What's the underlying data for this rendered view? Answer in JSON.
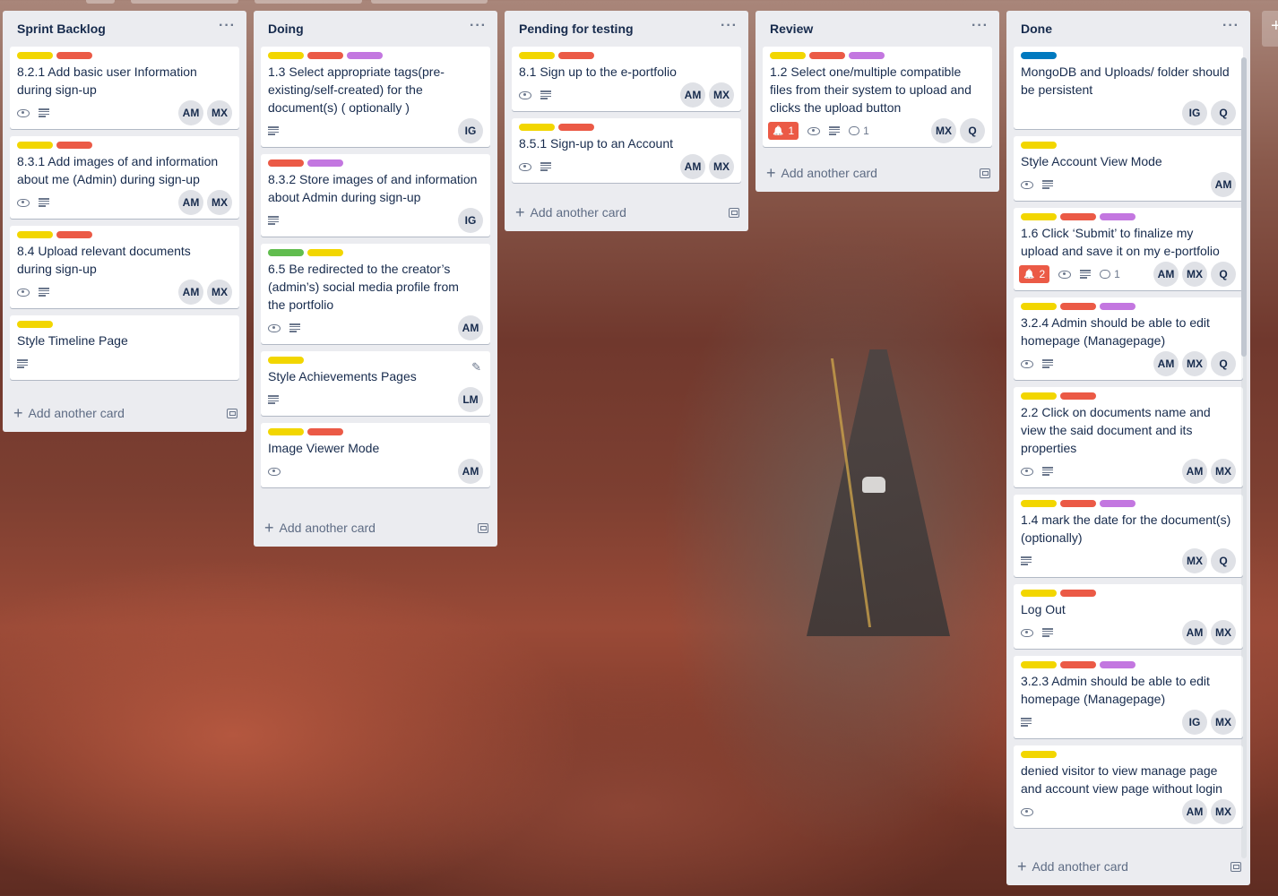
{
  "colors": {
    "yellow": "#f2d600",
    "red": "#eb5a46",
    "purple": "#c377e0",
    "green": "#61bd4f",
    "blue": "#0079bf"
  },
  "common": {
    "add_card_label": "Add another card",
    "list_menu_label": "···"
  },
  "lists": [
    {
      "title": "Sprint Backlog",
      "cards": [
        {
          "labels": [
            "yellow",
            "red"
          ],
          "title": "8.2.1 Add basic user Information during sign-up",
          "icons": [
            "eye-icon",
            "description-icon"
          ],
          "members": [
            "AM",
            "MX"
          ]
        },
        {
          "labels": [
            "yellow",
            "red"
          ],
          "title": "8.3.1 Add images of and information about me (Admin) during sign-up",
          "icons": [
            "eye-icon",
            "description-icon"
          ],
          "members": [
            "AM",
            "MX"
          ]
        },
        {
          "labels": [
            "yellow",
            "red"
          ],
          "title": "8.4 Upload relevant documents during sign-up",
          "icons": [
            "eye-icon",
            "description-icon"
          ],
          "members": [
            "AM",
            "MX"
          ]
        },
        {
          "labels": [
            "yellow"
          ],
          "title": "Style Timeline Page",
          "icons": [
            "description-icon"
          ],
          "members": []
        }
      ]
    },
    {
      "title": "Doing",
      "cards": [
        {
          "labels": [
            "yellow",
            "red",
            "purple"
          ],
          "title": "1.3 Select appropriate tags(pre-existing/self-created) for the document(s) ( optionally )",
          "icons": [
            "description-icon"
          ],
          "members": [
            "IG"
          ]
        },
        {
          "labels": [
            "red",
            "purple"
          ],
          "title": "8.3.2 Store images of and information about Admin during sign-up",
          "icons": [
            "description-icon"
          ],
          "members": [
            "IG"
          ]
        },
        {
          "labels": [
            "green",
            "yellow"
          ],
          "title": "6.5 Be redirected to the creator’s (admin’s) social media profile from the portfolio",
          "icons": [
            "eye-icon",
            "description-icon"
          ],
          "members": [
            "AM"
          ]
        },
        {
          "labels": [
            "yellow"
          ],
          "title": "Style Achievements Pages",
          "icons": [
            "description-icon"
          ],
          "members": [
            "LM"
          ],
          "edit": true
        },
        {
          "labels": [
            "yellow",
            "red"
          ],
          "title": "Image Viewer Mode",
          "icons": [
            "eye-icon"
          ],
          "members": [
            "AM"
          ]
        }
      ]
    },
    {
      "title": "Pending for testing",
      "cards": [
        {
          "labels": [
            "yellow",
            "red"
          ],
          "title": "8.1 Sign up to the e-portfolio",
          "icons": [
            "eye-icon",
            "description-icon"
          ],
          "members": [
            "AM",
            "MX"
          ]
        },
        {
          "labels": [
            "yellow",
            "red"
          ],
          "title": "8.5.1 Sign-up to an Account",
          "icons": [
            "eye-icon",
            "description-icon"
          ],
          "members": [
            "AM",
            "MX"
          ]
        }
      ]
    },
    {
      "title": "Review",
      "cards": [
        {
          "labels": [
            "yellow",
            "red",
            "purple"
          ],
          "title": "1.2 Select one/multiple compatible files from their system to upload and clicks the upload button",
          "due": "1",
          "icons": [
            "eye-icon",
            "description-icon"
          ],
          "comments": "1",
          "members": [
            "MX",
            "Q"
          ]
        }
      ]
    },
    {
      "title": "Done",
      "cards": [
        {
          "labels": [
            "blue"
          ],
          "title": "MongoDB and Uploads/ folder should be persistent",
          "icons": [],
          "members": [
            "IG",
            "Q"
          ]
        },
        {
          "labels": [
            "yellow"
          ],
          "title": "Style Account View Mode",
          "icons": [
            "eye-icon",
            "description-icon"
          ],
          "members": [
            "AM"
          ]
        },
        {
          "labels": [
            "yellow",
            "red",
            "purple"
          ],
          "title": "1.6 Click ‘Submit’ to finalize my upload and save it on my e-portfolio",
          "due": "2",
          "icons": [
            "eye-icon",
            "description-icon"
          ],
          "comments": "1",
          "members": [
            "AM",
            "MX",
            "Q"
          ]
        },
        {
          "labels": [
            "yellow",
            "red",
            "purple"
          ],
          "title": "3.2.4 Admin should be able to edit homepage (Managepage)",
          "icons": [
            "eye-icon",
            "description-icon"
          ],
          "members": [
            "AM",
            "MX",
            "Q"
          ]
        },
        {
          "labels": [
            "yellow",
            "red"
          ],
          "title": "2.2 Click on documents name and view the said document and its properties",
          "icons": [
            "eye-icon",
            "description-icon"
          ],
          "members": [
            "AM",
            "MX"
          ]
        },
        {
          "labels": [
            "yellow",
            "red",
            "purple"
          ],
          "title": "1.4 mark the date for the document(s) (optionally)",
          "icons": [
            "description-icon"
          ],
          "members": [
            "MX",
            "Q"
          ]
        },
        {
          "labels": [
            "yellow",
            "red"
          ],
          "title": "Log Out",
          "icons": [
            "eye-icon",
            "description-icon"
          ],
          "members": [
            "AM",
            "MX"
          ]
        },
        {
          "labels": [
            "yellow",
            "red",
            "purple"
          ],
          "title": "3.2.3 Admin should be able to edit homepage (Managepage)",
          "icons": [
            "description-icon"
          ],
          "members": [
            "IG",
            "MX"
          ]
        },
        {
          "labels": [
            "yellow"
          ],
          "title": "denied visitor to view manage page and account view page without login",
          "icons": [
            "eye-icon"
          ],
          "members": [
            "AM",
            "MX"
          ]
        }
      ]
    }
  ]
}
